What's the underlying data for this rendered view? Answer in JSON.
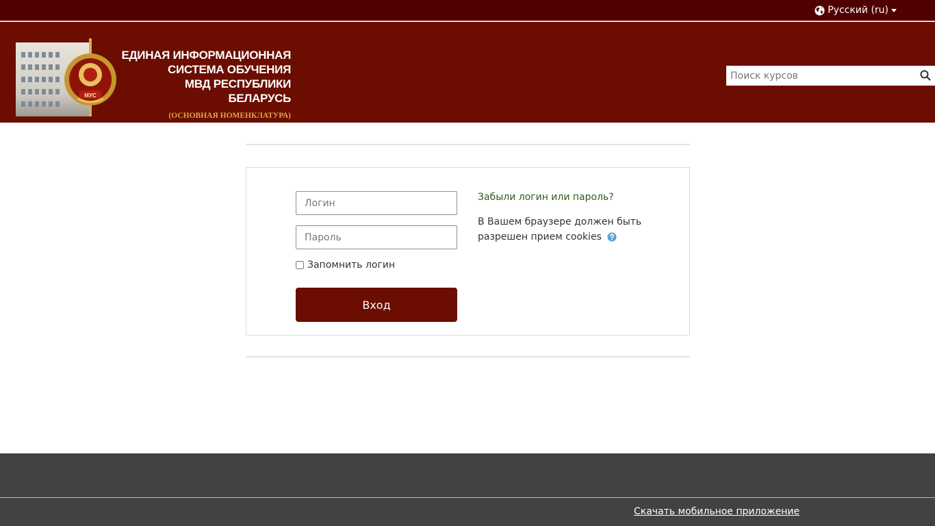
{
  "topbar": {
    "language_label": "Русский ‎(ru)‎"
  },
  "header": {
    "logo_lines": [
      "ЕДИНАЯ ИНФОРМАЦИОННАЯ",
      "СИСТЕМА ОБУЧЕНИЯ",
      "МВД РЕСПУБЛИКИ БЕЛАРУСЬ"
    ],
    "logo_subtitle": "(ОСНОВНАЯ НОМЕНКЛАТУРА)",
    "emblem_text": "МУС",
    "search_placeholder": "Поиск курсов"
  },
  "login": {
    "username_placeholder": "Логин",
    "username_value": "",
    "password_placeholder": "Пароль",
    "password_value": "",
    "remember_label": "Запомнить логин",
    "remember_checked": false,
    "submit_label": "Вход",
    "forgot_link": "Забыли логин или пароль?",
    "cookies_note": "В Вашем браузере должен быть разрешен прием cookies"
  },
  "footer": {
    "mobile_app_link": "Скачать мобильное приложение"
  },
  "colors": {
    "topbar": "#500000",
    "header": "#6b0d00",
    "button": "#6b0d00",
    "footer": "#424242",
    "link": "#2d5d1a",
    "help_icon": "#56a2d6"
  },
  "icons": {
    "language": "globe-icon",
    "search": "search-icon",
    "help": "question-circle-icon"
  }
}
